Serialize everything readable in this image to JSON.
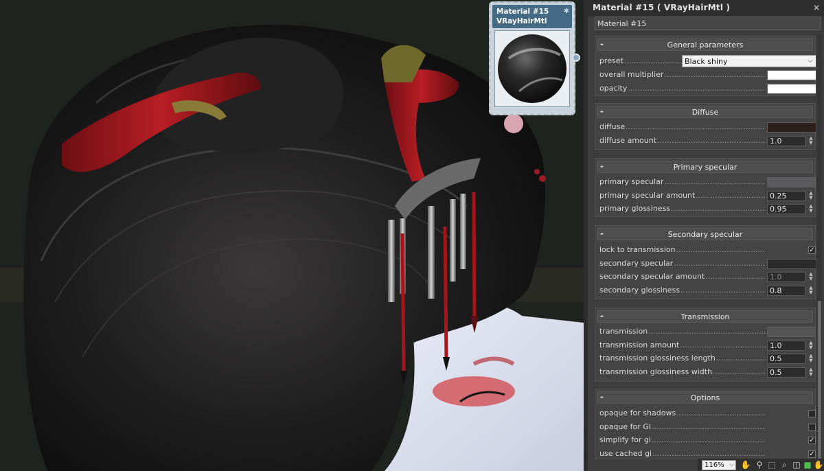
{
  "node": {
    "title": "Material #15",
    "subtitle": "VRayHairMtl"
  },
  "panel": {
    "title": "Material #15  ( VRayHairMtl )",
    "name_value": "Material #15",
    "close_icon": "×"
  },
  "rollouts": {
    "general": {
      "title": "General parameters",
      "toggle": "-",
      "preset_label": "preset",
      "preset_value": "Black shiny",
      "overall_multiplier_label": "overall multiplier",
      "opacity_label": "opacity",
      "overall_multiplier_color": "#ffffff",
      "opacity_color": "#ffffff"
    },
    "diffuse": {
      "title": "Diffuse",
      "toggle": "-",
      "diffuse_label": "diffuse",
      "diffuse_color": "#2c201c",
      "diffuse_amount_label": "diffuse amount",
      "diffuse_amount_value": "1.0"
    },
    "primary": {
      "title": "Primary specular",
      "toggle": "-",
      "specular_label": "primary specular",
      "specular_color": "#5b5b5e",
      "amount_label": "primary specular amount",
      "amount_value": "0.25",
      "glossiness_label": "primary glossiness",
      "glossiness_value": "0.95"
    },
    "secondary": {
      "title": "Secondary specular",
      "toggle": "-",
      "lock_label": "lock to transmission",
      "lock_checked": "✓",
      "specular_label": "secondary specular",
      "specular_color": "#2a2a2a",
      "amount_label": "secondary specular amount",
      "amount_value": "1.0",
      "glossiness_label": "secondary glossiness",
      "glossiness_value": "0.8"
    },
    "transmission": {
      "title": "Transmission",
      "toggle": "-",
      "transmission_label": "transmission",
      "transmission_color": "#545454",
      "amount_label": "transmission amount",
      "amount_value": "1.0",
      "gloss_length_label": "transmission glossiness length",
      "gloss_length_value": "0.5",
      "gloss_width_label": "transmission glossiness width",
      "gloss_width_value": "0.5"
    },
    "options": {
      "title": "Options",
      "toggle": "-",
      "opaque_shadows_label": "opaque for shadows",
      "opaque_gi_label": "opaque for GI",
      "simplify_gi_label": "simplify for gi",
      "use_cached_gi_label": "use cached gi",
      "checked_mark": "✓"
    }
  },
  "bottom_bar": {
    "zoom_value": "116%"
  },
  "icons": {
    "pan": "hand-icon",
    "zoom_region": "zoom-icon",
    "select_region": "region-icon",
    "close": "close-icon",
    "spinner": "spinner-arrows-icon"
  }
}
